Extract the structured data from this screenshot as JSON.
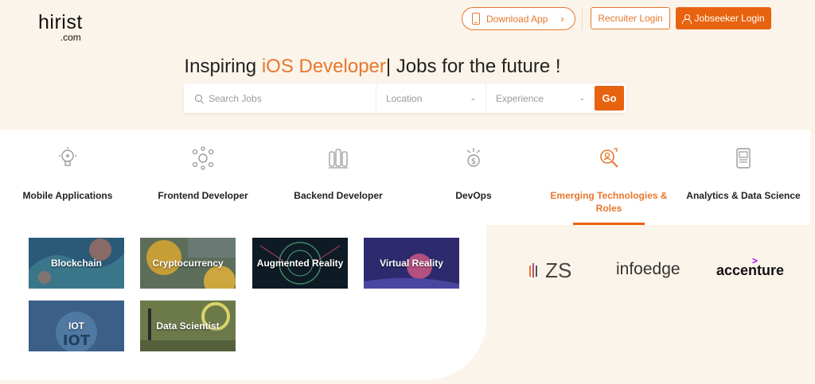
{
  "header": {
    "logo_name": "hirist",
    "logo_domain": ".com",
    "download_label": "Download App",
    "recruiter_label": "Recruiter Login",
    "jobseeker_label": "Jobseeker Login"
  },
  "hero": {
    "title_prefix": "Inspiring ",
    "title_highlight": "iOS Developer",
    "title_suffix": "| Jobs for the future !"
  },
  "search": {
    "jobs_placeholder": "Search Jobs",
    "location_placeholder": "Location",
    "experience_placeholder": "Experience",
    "go_label": "Go"
  },
  "categories": [
    {
      "label": "Mobile Applications",
      "icon": "lightbulb-icon",
      "active": false
    },
    {
      "label": "Frontend Developer",
      "icon": "network-icon",
      "active": false
    },
    {
      "label": "Backend Developer",
      "icon": "servers-icon",
      "active": false
    },
    {
      "label": "DevOps",
      "icon": "devops-icon",
      "active": false
    },
    {
      "label": "Emerging Technologies & Roles",
      "icon": "magnifier-icon",
      "active": true
    },
    {
      "label": "Analytics & Data Science",
      "icon": "analytics-icon",
      "active": false
    }
  ],
  "tiles": [
    {
      "label": "Blockchain"
    },
    {
      "label": "Cryptocurrency"
    },
    {
      "label": "Augmented Reality"
    },
    {
      "label": "Virtual Reality"
    },
    {
      "label": "IOT"
    },
    {
      "label": "Data Scientist"
    }
  ],
  "companies": {
    "zs": "ZS",
    "infoedge": "infoedge",
    "accenture": "accenture"
  },
  "colors": {
    "accent": "#e8630f",
    "accent_text": "#e8772e",
    "page_bg": "#fbf4ea"
  }
}
